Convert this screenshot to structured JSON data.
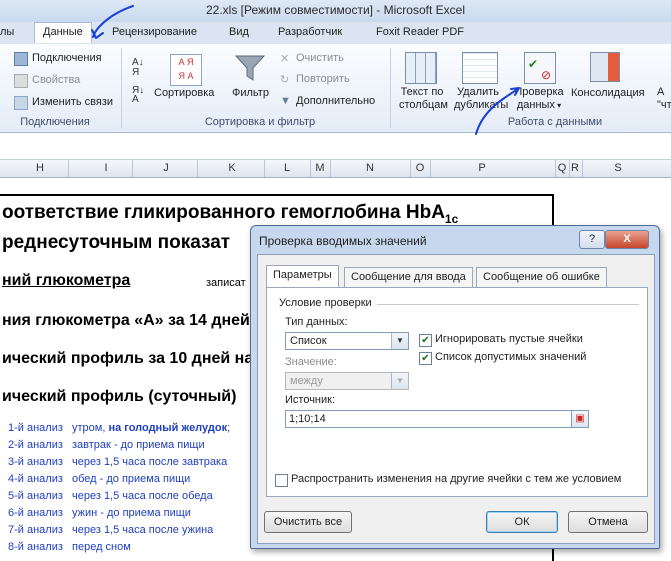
{
  "window": {
    "title": "22.xls  [Режим совместимости]  -  Microsoft Excel"
  },
  "ribbon_tabs": [
    "лы",
    "Данные",
    "Рецензирование",
    "Вид",
    "Разработчик",
    "Foxit Reader PDF"
  ],
  "ribbon": {
    "connections": {
      "items": [
        "Подключения",
        "Свойства",
        "Изменить связи"
      ],
      "label": "Подключения"
    },
    "sort_filter": {
      "sort": "Сортировка",
      "filter": "Фильтр",
      "clear": "Очистить",
      "reapply": "Повторить",
      "advanced": "Дополнительно",
      "label": "Сортировка и фильтр"
    },
    "data_tools": {
      "text_to_columns": [
        "Текст по",
        "столбцам"
      ],
      "remove_duplicates": [
        "Удалить",
        "дубликаты"
      ],
      "data_validation": [
        "Проверка",
        "данных"
      ],
      "consolidate": "Консолидация",
      "whatif": [
        "А",
        "\"чт"
      ],
      "label": "Работа с данными"
    }
  },
  "columns": [
    "H",
    "I",
    "J",
    "K",
    "L",
    "M",
    "N",
    "O",
    "P",
    "Q",
    "R",
    "S"
  ],
  "sheet": {
    "heading1a": "оответствие гликированного гемоглобина HbA",
    "heading1a_sub": "1c",
    "heading1b": "реднесуточным показат",
    "glucometer": "ний глюкометра",
    "recorded": "записат",
    "readings14": "ния глюкометра «А» за 14 дней",
    "profile10": "ический профиль за 10 дней на",
    "profile_daily": "ический профиль (суточный)",
    "analyses": [
      {
        "n": "1-й анализ",
        "t": "утром, ",
        "b": "на голодный желудок",
        "e": ";"
      },
      {
        "n": "2-й анализ",
        "t": "завтрак - до приема пищи"
      },
      {
        "n": "3-й анализ",
        "t": "через 1,5 часа после завтрака"
      },
      {
        "n": "4-й анализ",
        "t": "обед - до приема пищи"
      },
      {
        "n": "5-й анализ",
        "t": "через 1,5 часа после обеда"
      },
      {
        "n": "6-й анализ",
        "t": "ужин - до приема пищи"
      },
      {
        "n": "7-й анализ",
        "t": "через 1,5 часа после ужина"
      },
      {
        "n": "8-й анализ",
        "t": "перед сном"
      }
    ]
  },
  "dialog": {
    "title": "Проверка вводимых значений",
    "help": "?",
    "close": "X",
    "tabs": [
      "Параметры",
      "Сообщение для ввода",
      "Сообщение об ошибке"
    ],
    "section": "Условие проверки",
    "type_label": "Тип данных:",
    "type_value": "Список",
    "ignore_blank": "Игнорировать пустые ячейки",
    "in_cell_dropdown": "Список допустимых значений",
    "value_label": "Значение:",
    "value_value": "между",
    "source_label": "Источник:",
    "source_value": "1;10;14",
    "apply_all": "Распространить изменения на другие ячейки с тем же условием",
    "clear_all": "Очистить все",
    "ok": "ОК",
    "cancel": "Отмена"
  },
  "colors": {
    "accent_blue": "#1f3fbf",
    "annotation": "#1a3fd6"
  }
}
